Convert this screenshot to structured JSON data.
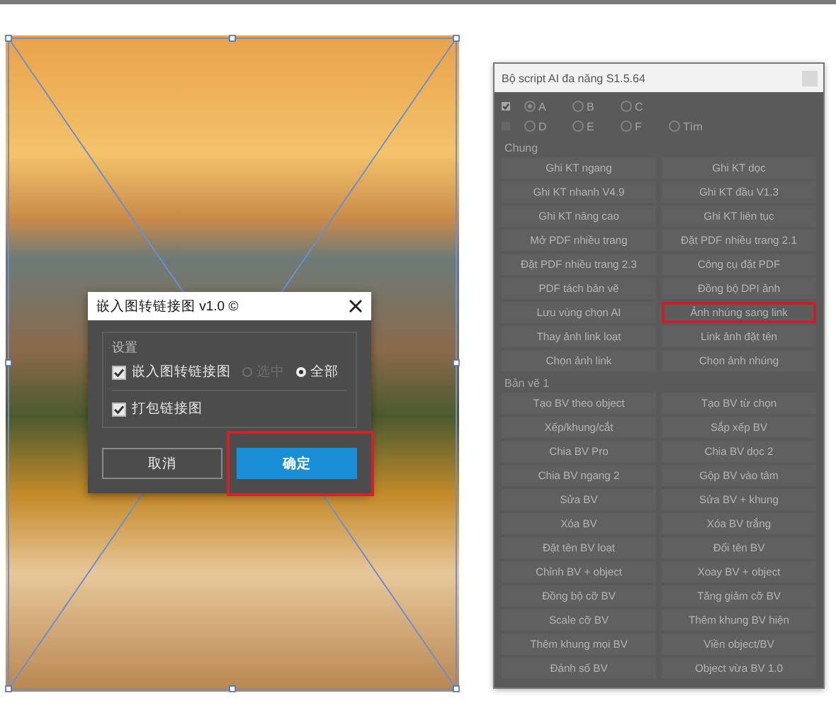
{
  "dialog": {
    "title": "嵌入图转链接图 v1.0 ©",
    "group_title": "设置",
    "options": [
      {
        "kind": "checkbox",
        "label": "嵌入图转链接图",
        "checked": true,
        "radios": [
          {
            "label": "选中",
            "selected": false,
            "disabled": true
          },
          {
            "label": "全部",
            "selected": true,
            "disabled": false
          }
        ]
      },
      {
        "kind": "checkbox",
        "label": "打包链接图",
        "checked": true
      }
    ],
    "buttons": [
      {
        "label": "取消",
        "kind": "secondary",
        "highlighted": false
      },
      {
        "label": "确定",
        "kind": "primary",
        "highlighted": true
      }
    ]
  },
  "panel": {
    "title": "Bộ script AI đa năng S1.5.64",
    "disabled": true,
    "radio_rows": [
      {
        "checked": true,
        "radios": [
          {
            "label": "A",
            "selected": true
          },
          {
            "label": "B",
            "selected": false
          },
          {
            "label": "C",
            "selected": false
          }
        ]
      },
      {
        "checked": false,
        "radios": [
          {
            "label": "D",
            "selected": false
          },
          {
            "label": "E",
            "selected": false
          },
          {
            "label": "F",
            "selected": false
          },
          {
            "label": "Tìm",
            "selected": false
          }
        ]
      }
    ],
    "sections": [
      {
        "title": "Chung",
        "buttons": [
          {
            "label": "Ghi KT ngang",
            "highlighted": false
          },
          {
            "label": "Ghi KT dọc",
            "highlighted": false
          },
          {
            "label": "Ghi KT nhanh V4.9",
            "highlighted": false
          },
          {
            "label": "Ghi KT đầu V1.3",
            "highlighted": false
          },
          {
            "label": "Ghi KT nâng cao",
            "highlighted": false
          },
          {
            "label": "Ghi KT liên tục",
            "highlighted": false
          },
          {
            "label": "Mở PDF nhiều trang",
            "highlighted": false
          },
          {
            "label": "Đặt PDF nhiều trang 2.1",
            "highlighted": false
          },
          {
            "label": "Đặt PDF nhiều trang 2.3",
            "highlighted": false
          },
          {
            "label": "Công cụ đặt PDF",
            "highlighted": false
          },
          {
            "label": "PDF tách bản vẽ",
            "highlighted": false
          },
          {
            "label": "Đồng bộ DPI ảnh",
            "highlighted": false
          },
          {
            "label": "Lưu vùng chọn AI",
            "highlighted": false
          },
          {
            "label": "Ảnh nhúng sang link",
            "highlighted": true
          },
          {
            "label": "Thay ảnh link loạt",
            "highlighted": false
          },
          {
            "label": "Link ảnh đặt tên",
            "highlighted": false
          },
          {
            "label": "Chọn ảnh link",
            "highlighted": false
          },
          {
            "label": "Chọn ảnh nhúng",
            "highlighted": false
          }
        ]
      },
      {
        "title": "Bản vẽ 1",
        "buttons": [
          {
            "label": "Tạo BV theo object",
            "highlighted": false
          },
          {
            "label": "Tạo BV từ chọn",
            "highlighted": false
          },
          {
            "label": "Xếp/khung/cắt",
            "highlighted": false
          },
          {
            "label": "Sắp xếp BV",
            "highlighted": false
          },
          {
            "label": "Chia BV Pro",
            "highlighted": false
          },
          {
            "label": "Chia BV dọc 2",
            "highlighted": false
          },
          {
            "label": "Chia BV ngang 2",
            "highlighted": false
          },
          {
            "label": "Gộp BV vào tâm",
            "highlighted": false
          },
          {
            "label": "Sửa BV",
            "highlighted": false
          },
          {
            "label": "Sửa BV + khung",
            "highlighted": false
          },
          {
            "label": "Xóa BV",
            "highlighted": false
          },
          {
            "label": "Xóa BV trắng",
            "highlighted": false
          },
          {
            "label": "Đặt tên BV loạt",
            "highlighted": false
          },
          {
            "label": "Đổi tên BV",
            "highlighted": false
          },
          {
            "label": "Chỉnh BV + object",
            "highlighted": false
          },
          {
            "label": "Xoay BV + object",
            "highlighted": false
          },
          {
            "label": "Đồng bộ cỡ BV",
            "highlighted": false
          },
          {
            "label": "Tăng giảm cỡ BV",
            "highlighted": false
          },
          {
            "label": "Scale cỡ BV",
            "highlighted": false
          },
          {
            "label": "Thêm khung BV hiện",
            "highlighted": false
          },
          {
            "label": "Thêm khung mọi BV",
            "highlighted": false
          },
          {
            "label": "Viền object/BV",
            "highlighted": false
          },
          {
            "label": "Đánh số BV",
            "highlighted": false
          },
          {
            "label": "Object vừa BV 1.0",
            "highlighted": false
          }
        ]
      }
    ]
  }
}
